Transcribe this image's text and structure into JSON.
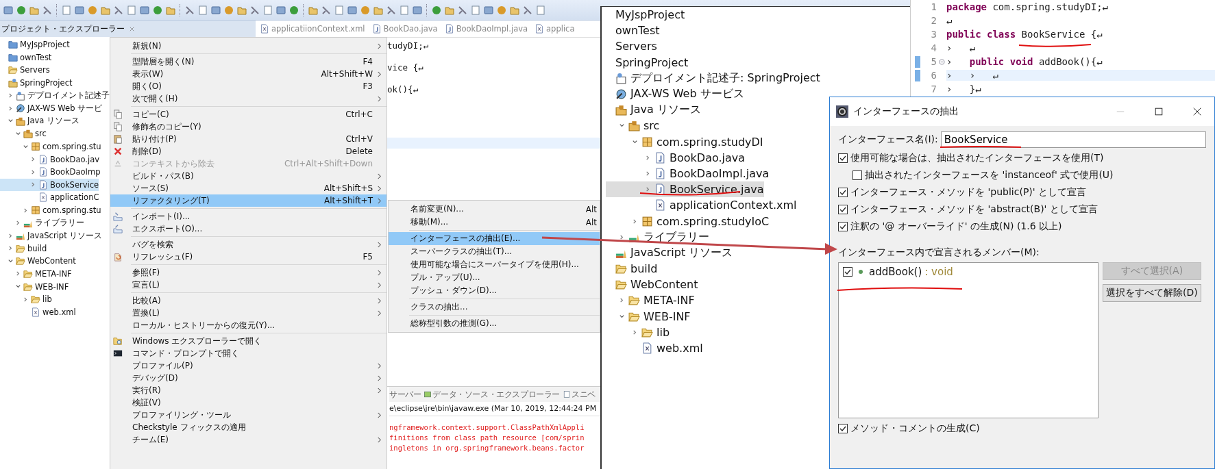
{
  "explorer": {
    "title": "プロジェクト・エクスプローラー",
    "tree": [
      {
        "label": "MyJspProject",
        "kind": "project",
        "selected": false
      },
      {
        "label": "ownTest",
        "kind": "project",
        "selected": false
      },
      {
        "label": "Servers",
        "kind": "folder",
        "selected": false
      },
      {
        "label": "SpringProject",
        "kind": "webproject",
        "selected": false,
        "children": [
          {
            "label": "デプロイメント記述子",
            "kind": "descriptor",
            "selected": false,
            "expanded": false
          },
          {
            "label": "JAX-WS Web サービ",
            "kind": "webservice",
            "selected": false,
            "expanded": false
          },
          {
            "label": "Java リソース",
            "kind": "javares",
            "selected": false,
            "expanded": true,
            "children": [
              {
                "label": "src",
                "kind": "src",
                "selected": false,
                "expanded": true,
                "children": [
                  {
                    "label": "com.spring.stu",
                    "kind": "package",
                    "selected": false,
                    "expanded": true,
                    "children": [
                      {
                        "label": "BookDao.jav",
                        "kind": "java",
                        "selected": false,
                        "expanded": false
                      },
                      {
                        "label": "BookDaoImp",
                        "kind": "java",
                        "selected": false,
                        "expanded": false
                      },
                      {
                        "label": "BookService",
                        "kind": "java",
                        "selected": true,
                        "expanded": false
                      },
                      {
                        "label": "applicationC",
                        "kind": "xml",
                        "selected": false
                      }
                    ]
                  },
                  {
                    "label": "com.spring.stu",
                    "kind": "package",
                    "selected": false,
                    "expanded": false
                  }
                ]
              },
              {
                "label": "ライブラリー",
                "kind": "library",
                "selected": false,
                "expanded": false
              }
            ]
          },
          {
            "label": "JavaScript リソース",
            "kind": "library",
            "selected": false,
            "expanded": false
          },
          {
            "label": "build",
            "kind": "folder",
            "selected": false,
            "expanded": false
          },
          {
            "label": "WebContent",
            "kind": "folder",
            "selected": false,
            "expanded": true,
            "children": [
              {
                "label": "META-INF",
                "kind": "folder",
                "selected": false,
                "expanded": false
              },
              {
                "label": "WEB-INF",
                "kind": "folder",
                "selected": false,
                "expanded": true,
                "children": [
                  {
                    "label": "lib",
                    "kind": "folder",
                    "selected": false,
                    "expanded": false
                  },
                  {
                    "label": "web.xml",
                    "kind": "xml",
                    "selected": false
                  }
                ]
              }
            ]
          }
        ]
      }
    ]
  },
  "editor_tabs": [
    {
      "label": "applicatiionContext.xml",
      "kind": "xml",
      "selected": false
    },
    {
      "label": "BookDao.java",
      "kind": "java",
      "selected": false
    },
    {
      "label": "BookDaoImpl.java",
      "kind": "java",
      "selected": false
    },
    {
      "label": "applica",
      "kind": "xml",
      "selected": false
    }
  ],
  "editor_lines": [
    "tudyDI;↵",
    "vice {↵",
    "ok(){↵"
  ],
  "console": {
    "tabs": [
      {
        "label": "サーバー",
        "kind": "server"
      },
      {
        "label": "データ・ソース・エクスプローラー",
        "kind": "datasource"
      },
      {
        "label": "スニペ",
        "kind": "snippet"
      }
    ],
    "header": "e\\eclipse\\jre\\bin\\javaw.exe (Mar 10, 2019, 12:44:24 PM",
    "lines": [
      "ngframework.context.support.ClassPathXmlAppli",
      "finitions from class path resource [com/sprin",
      "ingletons in org.springframework.beans.factor"
    ]
  },
  "context_menu": {
    "groups": [
      [
        {
          "label": "新規(N)",
          "submenu": true,
          "disabled": false,
          "selected": false
        }
      ],
      [
        {
          "label": "型階層を開く(N)",
          "shortcut": "F4",
          "submenu": false,
          "disabled": false,
          "selected": false
        },
        {
          "label": "表示(W)",
          "shortcut": "Alt+Shift+W",
          "submenu": true,
          "disabled": false,
          "selected": false
        },
        {
          "label": "開く(O)",
          "shortcut": "F3",
          "submenu": false,
          "disabled": false,
          "selected": false
        },
        {
          "label": "次で開く(H)",
          "submenu": true,
          "disabled": false,
          "selected": false
        }
      ],
      [
        {
          "label": "コピー(C)",
          "shortcut": "Ctrl+C",
          "kind": "copy",
          "submenu": false,
          "disabled": false,
          "selected": false
        },
        {
          "label": "修飾名のコピー(Y)",
          "kind": "copy",
          "submenu": false,
          "disabled": false,
          "selected": false
        },
        {
          "label": "貼り付け(P)",
          "shortcut": "Ctrl+V",
          "kind": "paste",
          "submenu": false,
          "disabled": false,
          "selected": false
        },
        {
          "label": "削除(D)",
          "shortcut": "Delete",
          "kind": "delete",
          "submenu": false,
          "disabled": false,
          "selected": false
        },
        {
          "label": "コンテキストから除去",
          "shortcut": "Ctrl+Alt+Shift+Down",
          "kind": "remove",
          "submenu": false,
          "disabled": true,
          "selected": false
        },
        {
          "label": "ビルド・パス(B)",
          "submenu": true,
          "disabled": false,
          "selected": false
        },
        {
          "label": "ソース(S)",
          "shortcut": "Alt+Shift+S",
          "submenu": true,
          "disabled": false,
          "selected": false
        },
        {
          "label": "リファクタリング(T)",
          "shortcut": "Alt+Shift+T",
          "submenu": true,
          "disabled": false,
          "selected": true
        }
      ],
      [
        {
          "label": "インポート(I)...",
          "kind": "import",
          "submenu": false,
          "disabled": false,
          "selected": false
        },
        {
          "label": "エクスポート(O)...",
          "kind": "export",
          "submenu": false,
          "disabled": false,
          "selected": false
        }
      ],
      [
        {
          "label": "バグを検索",
          "submenu": true,
          "disabled": false,
          "selected": false
        },
        {
          "label": "リフレッシュ(F)",
          "shortcut": "F5",
          "kind": "refresh",
          "submenu": false,
          "disabled": false,
          "selected": false
        }
      ],
      [
        {
          "label": "参照(F)",
          "submenu": true,
          "disabled": false,
          "selected": false
        },
        {
          "label": "宣言(L)",
          "submenu": true,
          "disabled": false,
          "selected": false
        }
      ],
      [
        {
          "label": "比較(A)",
          "submenu": true,
          "disabled": false,
          "selected": false
        },
        {
          "label": "置換(L)",
          "submenu": true,
          "disabled": false,
          "selected": false
        },
        {
          "label": "ローカル・ヒストリーからの復元(Y)...",
          "submenu": false,
          "disabled": false,
          "selected": false
        }
      ],
      [
        {
          "label": "Windows エクスプローラーで開く",
          "kind": "explorer",
          "submenu": false,
          "disabled": false,
          "selected": false
        },
        {
          "label": "コマンド・プロンプトで開く",
          "kind": "console",
          "submenu": false,
          "disabled": false,
          "selected": false
        },
        {
          "label": "プロファイル(P)",
          "submenu": true,
          "disabled": false,
          "selected": false
        },
        {
          "label": "デバッグ(D)",
          "submenu": true,
          "disabled": false,
          "selected": false
        },
        {
          "label": "実行(R)",
          "submenu": true,
          "disabled": false,
          "selected": false
        },
        {
          "label": "検証(V)",
          "submenu": false,
          "disabled": false,
          "selected": false
        },
        {
          "label": "プロファイリング・ツール",
          "submenu": true,
          "disabled": false,
          "selected": false
        },
        {
          "label": "Checkstyle フィックスの適用",
          "submenu": false,
          "disabled": false,
          "selected": false
        },
        {
          "label": "チーム(E)",
          "submenu": true,
          "disabled": false,
          "selected": false
        }
      ]
    ]
  },
  "submenu": {
    "groups": [
      [
        {
          "label": "名前変更(N)...",
          "shortcut": "Alt",
          "selected": false
        },
        {
          "label": "移動(M)...",
          "shortcut": "Alt",
          "selected": false
        }
      ],
      [
        {
          "label": "インターフェースの抽出(E)...",
          "selected": true
        },
        {
          "label": "スーパークラスの抽出(T)...",
          "selected": false
        },
        {
          "label": "使用可能な場合にスーパータイプを使用(H)...",
          "selected": false
        },
        {
          "label": "プル・アップ(U)...",
          "selected": false
        },
        {
          "label": "プッシュ・ダウン(D)...",
          "selected": false
        }
      ],
      [
        {
          "label": "クラスの抽出...",
          "selected": false
        }
      ],
      [
        {
          "label": "総称型引数の推測(G)...",
          "selected": false
        }
      ]
    ]
  },
  "overlay_tree": [
    {
      "label": "MyJspProject",
      "kind": "plain",
      "selected": false
    },
    {
      "label": "ownTest",
      "kind": "plain",
      "selected": false
    },
    {
      "label": "Servers",
      "kind": "plain",
      "selected": false
    },
    {
      "label": "SpringProject",
      "kind": "plain",
      "selected": false
    },
    {
      "label": "デプロイメント記述子: SpringProject",
      "kind": "descriptor",
      "selected": false
    },
    {
      "label": "JAX-WS Web サービス",
      "kind": "webservice",
      "selected": false
    },
    {
      "label": "Java リソース",
      "kind": "javares",
      "selected": false,
      "children": [
        {
          "label": "src",
          "kind": "src",
          "selected": false,
          "expanded": true,
          "children": [
            {
              "label": "com.spring.studyDI",
              "kind": "package",
              "selected": false,
              "expanded": true,
              "children": [
                {
                  "label": "BookDao.java",
                  "kind": "java",
                  "selected": false,
                  "expanded": false
                },
                {
                  "label": "BookDaoImpl.java",
                  "kind": "java",
                  "selected": false,
                  "expanded": false
                },
                {
                  "label": "BookService.java",
                  "kind": "java",
                  "selected": true,
                  "expanded": false
                },
                {
                  "label": "applicationContext.xml",
                  "kind": "xml",
                  "selected": false
                }
              ]
            },
            {
              "label": "com.spring.studyIoC",
              "kind": "package",
              "selected": false,
              "expanded": false
            }
          ]
        },
        {
          "label": "ライブラリー",
          "kind": "library",
          "selected": false,
          "expanded": false
        }
      ]
    },
    {
      "label": "JavaScript リソース",
      "kind": "library",
      "selected": false
    },
    {
      "label": "build",
      "kind": "folder",
      "selected": false
    },
    {
      "label": "WebContent",
      "kind": "folder",
      "selected": false,
      "children": [
        {
          "label": "META-INF",
          "kind": "folder",
          "selected": false,
          "expanded": false
        },
        {
          "label": "WEB-INF",
          "kind": "folder",
          "selected": false,
          "expanded": true,
          "children": [
            {
              "label": "lib",
              "kind": "folder",
              "selected": false,
              "expanded": false
            },
            {
              "label": "web.xml",
              "kind": "xml",
              "selected": false
            }
          ]
        }
      ]
    }
  ],
  "code": [
    {
      "number": "1",
      "text": "**package** com.spring.studyDI;↵",
      "current": false,
      "fold": false
    },
    {
      "number": "2",
      "text": "↵",
      "current": false,
      "fold": false
    },
    {
      "number": "3",
      "text": "**public** **class** BookService {↵",
      "current": false,
      "fold": false
    },
    {
      "number": "4",
      "text": "›   ↵",
      "current": false,
      "fold": false
    },
    {
      "number": "5",
      "text": "›   **public** **void** addBook(){↵",
      "current": false,
      "fold": true
    },
    {
      "number": "6",
      "text": "›   ›   ↵",
      "current": true,
      "fold": false
    },
    {
      "number": "7",
      "text": "›   }↵",
      "current": false,
      "fold": false
    }
  ],
  "dialog": {
    "title": "インターフェースの抽出",
    "name_label": "インターフェース名(I):",
    "name_value": "BookService",
    "options": [
      {
        "label": "使用可能な場合は、抽出されたインターフェースを使用(T)",
        "checked": true,
        "children": [
          {
            "label": "抽出されたインターフェースを 'instanceof' 式で使用(U)",
            "checked": false
          }
        ]
      },
      {
        "label": "インターフェース・メソッドを 'public(P)' として宣言",
        "checked": true
      },
      {
        "label": "インターフェース・メソッドを 'abstract(B)' として宣言",
        "checked": true
      },
      {
        "label": "注釈の '@ オーバーライド' の生成(N) (1.6 以上)",
        "checked": true
      }
    ],
    "members_label": "インターフェース内で宣言されるメンバー(M):",
    "members": [
      {
        "name": "addBook()",
        "type": ": void",
        "checked": true
      }
    ],
    "buttons": [
      {
        "label": "すべて選択(A)",
        "disabled": true
      },
      {
        "label": "選択をすべて解除(D)",
        "disabled": false
      }
    ],
    "comment_option": {
      "label": "メソッド・コメントの生成(C)",
      "checked": true
    }
  }
}
